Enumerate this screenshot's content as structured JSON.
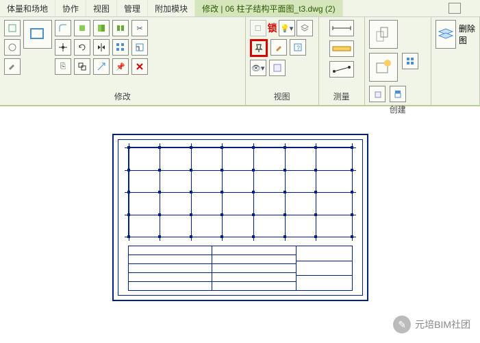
{
  "tabs": {
    "t0": "体量和场地",
    "t1": "协作",
    "t2": "视图",
    "t3": "管理",
    "t4": "附加模块",
    "active": "修改 | 06 柱子结构平面图_t3.dwg (2)"
  },
  "panels": {
    "modify": "修改",
    "view": "视图",
    "measure": "测量",
    "create": "创建",
    "delete": "删除图"
  },
  "lock_label": "锁",
  "watermark": "元培BIM社团",
  "chart_data": {
    "type": "table",
    "description": "CAD structural column layout drawing (柱子结构平面图) showing a grid of column positions with a title block/schedule at bottom. Specific dimensions and labels are not legible at this zoom level.",
    "grid": {
      "cols": 8,
      "rows": 5
    }
  }
}
